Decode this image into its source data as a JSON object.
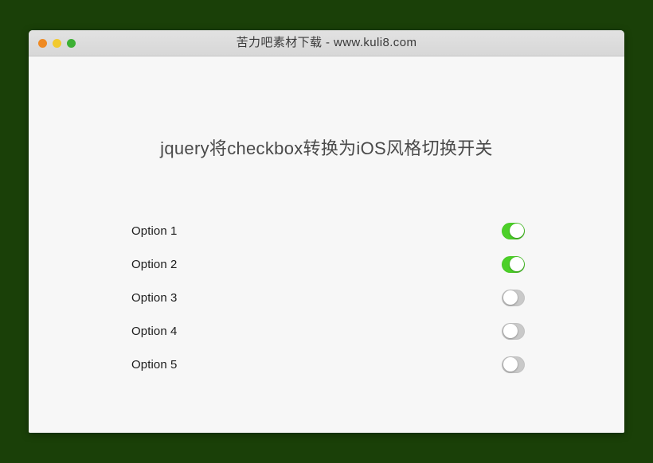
{
  "page": {
    "background_color": "#1a4008"
  },
  "window": {
    "title": "苦力吧素材下载 - www.kuli8.com",
    "body_color": "#f7f7f7",
    "titlebar_color": "#dcdcdc",
    "traffic_lights": [
      {
        "name": "close",
        "color": "#ef8a23"
      },
      {
        "name": "minimize",
        "color": "#f2ca2e"
      },
      {
        "name": "maximize",
        "color": "#3cb034"
      }
    ]
  },
  "main": {
    "heading": "jquery将checkbox转换为iOS风格切换开关",
    "toggle_on_color": "#4cd028",
    "toggle_off_color": "#c9c9c9",
    "options": [
      {
        "label": "Option 1",
        "state": "on"
      },
      {
        "label": "Option 2",
        "state": "on"
      },
      {
        "label": "Option 3",
        "state": "off"
      },
      {
        "label": "Option 4",
        "state": "off"
      },
      {
        "label": "Option 5",
        "state": "off"
      }
    ]
  }
}
